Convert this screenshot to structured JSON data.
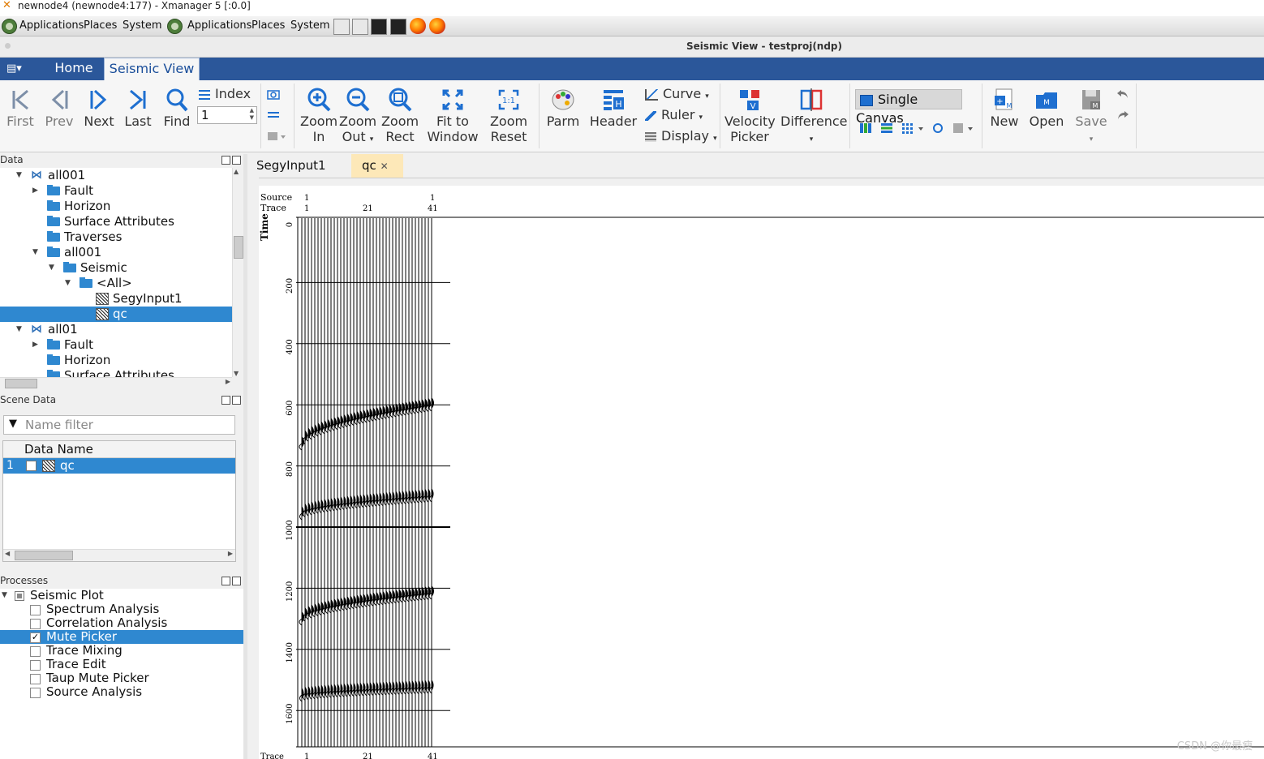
{
  "xmanager": {
    "title": "newnode4 (newnode4:177) - Xmanager 5 [:0.0]"
  },
  "gnome_panel": {
    "menus_1": [
      "Applications",
      "Places",
      "System"
    ],
    "menus_2": [
      "Applications",
      "Places",
      "System"
    ]
  },
  "window": {
    "title": "Seismic View - testproj(ndp)"
  },
  "ribbon_tabs": {
    "home": "Home",
    "seismic_view": "Seismic View"
  },
  "toolbar": {
    "first": "First",
    "prev": "Prev",
    "next": "Next",
    "last": "Last",
    "find": "Find",
    "index_label": "Index",
    "index_value": "1",
    "zoom_in": [
      "Zoom",
      "In"
    ],
    "zoom_out": [
      "Zoom",
      "Out"
    ],
    "zoom_rect": [
      "Zoom",
      "Rect"
    ],
    "fit_to_window": [
      "Fit to",
      "Window"
    ],
    "zoom_reset": [
      "Zoom",
      "Reset"
    ],
    "parm": "Parm",
    "header": "Header",
    "curve": "Curve",
    "ruler": "Ruler",
    "display": "Display",
    "velocity_picker": [
      "Velocity",
      "Picker"
    ],
    "difference": "Difference",
    "single_canvas": "Single Canvas",
    "new": "New",
    "open": "Open",
    "save": "Save"
  },
  "data_panel": {
    "title": "Data",
    "tree": [
      "all001",
      "Fault",
      "Horizon",
      "Surface Attributes",
      "Traverses",
      "all001",
      "Seismic",
      "<All>",
      "SegyInput1",
      "qc",
      "all01",
      "Fault",
      "Horizon",
      "Surface Attributes"
    ],
    "selected": "qc"
  },
  "scene_panel": {
    "title": "Scene Data",
    "filter_placeholder": "Name filter",
    "column": "Data Name",
    "rows": [
      {
        "index": "1",
        "name": "qc"
      }
    ]
  },
  "processes_panel": {
    "title": "Processes",
    "root": "Seismic Plot",
    "items": [
      {
        "label": "Spectrum Analysis",
        "checked": false
      },
      {
        "label": "Correlation Analysis",
        "checked": false
      },
      {
        "label": "Mute Picker",
        "checked": true
      },
      {
        "label": "Trace Mixing",
        "checked": false
      },
      {
        "label": "Trace Edit",
        "checked": false
      },
      {
        "label": "Taup Mute Picker",
        "checked": false
      },
      {
        "label": "Source Analysis",
        "checked": false
      }
    ]
  },
  "doc_tabs": {
    "tab1": "SegyInput1",
    "tab2": "qc"
  },
  "seismic_plot": {
    "source_label": "Source",
    "trace_label": "Trace",
    "time_label": "Time",
    "source_ticks": [
      "1",
      "1"
    ],
    "trace_ticks": [
      "1",
      "21",
      "41"
    ],
    "time_ticks": [
      "0",
      "200",
      "400",
      "600",
      "800",
      "1000",
      "1200",
      "1400",
      "1600"
    ],
    "bottom_trace_label": "Trace"
  },
  "watermark": "CSDN @你最瘦"
}
